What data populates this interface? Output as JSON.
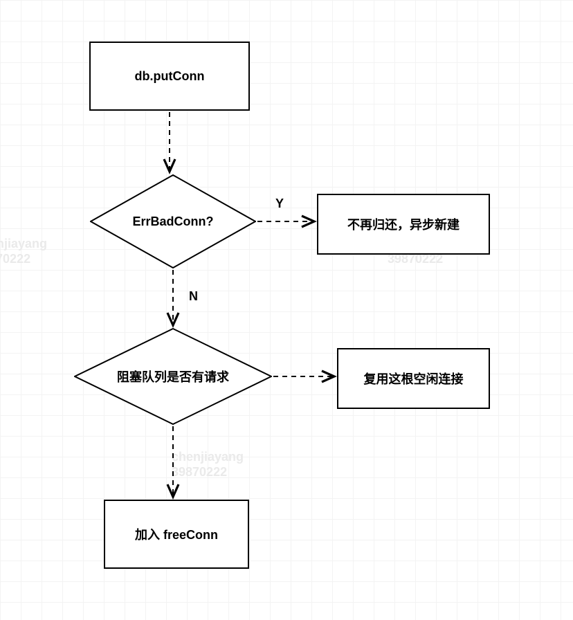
{
  "chart_data": {
    "type": "flowchart",
    "nodes": [
      {
        "id": "start",
        "shape": "rect",
        "label": "db.putConn"
      },
      {
        "id": "d1",
        "shape": "diamond",
        "label": "ErrBadConn?"
      },
      {
        "id": "r1",
        "shape": "rect",
        "label": "不再归还，异步新建"
      },
      {
        "id": "d2",
        "shape": "diamond",
        "label": "阻塞队列是否有请求"
      },
      {
        "id": "r2",
        "shape": "rect",
        "label": "复用这根空闲连接"
      },
      {
        "id": "end",
        "shape": "rect",
        "label": "加入 freeConn"
      }
    ],
    "edges": [
      {
        "from": "start",
        "to": "d1",
        "label": ""
      },
      {
        "from": "d1",
        "to": "r1",
        "label": "Y"
      },
      {
        "from": "d1",
        "to": "d2",
        "label": "N"
      },
      {
        "from": "d2",
        "to": "r2",
        "label": ""
      },
      {
        "from": "d2",
        "to": "end",
        "label": ""
      }
    ]
  },
  "nodes": {
    "start": "db.putConn",
    "d1": "ErrBadConn?",
    "r1": "不再归还，异步新建",
    "d2": "阻塞队列是否有请求",
    "r2": "复用这根空闲连接",
    "end": "加入 freeConn"
  },
  "labels": {
    "y": "Y",
    "n": "N"
  },
  "watermark": {
    "name": "chenjiayang",
    "num": "39870222"
  }
}
